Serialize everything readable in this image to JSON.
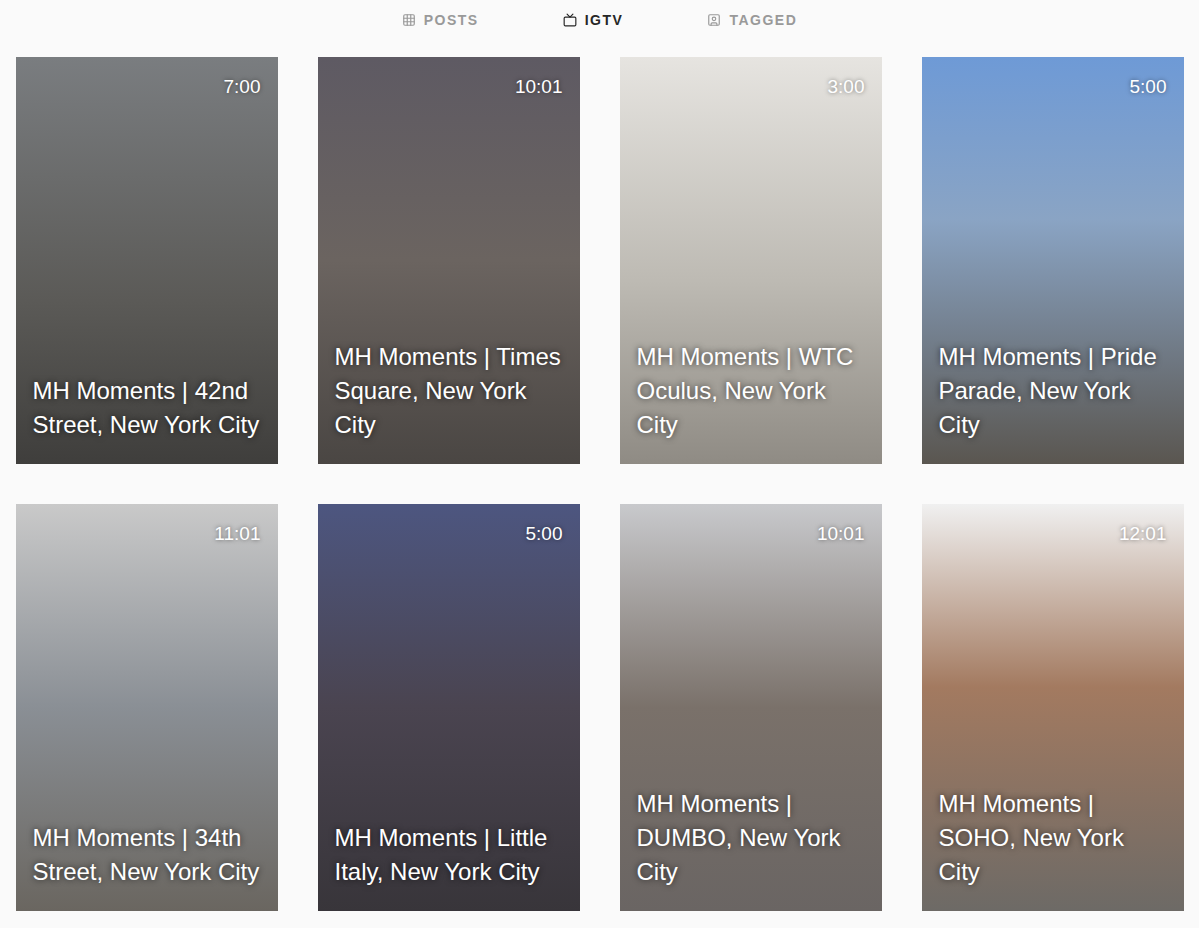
{
  "tabs": [
    {
      "label": "POSTS",
      "selected": false
    },
    {
      "label": "IGTV",
      "selected": true
    },
    {
      "label": "TAGGED",
      "selected": false
    }
  ],
  "videos": [
    {
      "title": "MH Moments | 42nd Street, New York City",
      "duration": "7:00"
    },
    {
      "title": "MH Moments | Times Square, New York City",
      "duration": "10:01"
    },
    {
      "title": "MH Moments | WTC Oculus, New York City",
      "duration": "3:00"
    },
    {
      "title": "MH Moments | Pride Parade, New York City",
      "duration": "5:00"
    },
    {
      "title": "MH Moments | 34th Street, New York City",
      "duration": "11:01"
    },
    {
      "title": "MH Moments | Little Italy, New York City",
      "duration": "5:00"
    },
    {
      "title": "MH Moments | DUMBO, New York City",
      "duration": "10:01"
    },
    {
      "title": "MH Moments | SOHO, New York City",
      "duration": "12:01"
    }
  ]
}
